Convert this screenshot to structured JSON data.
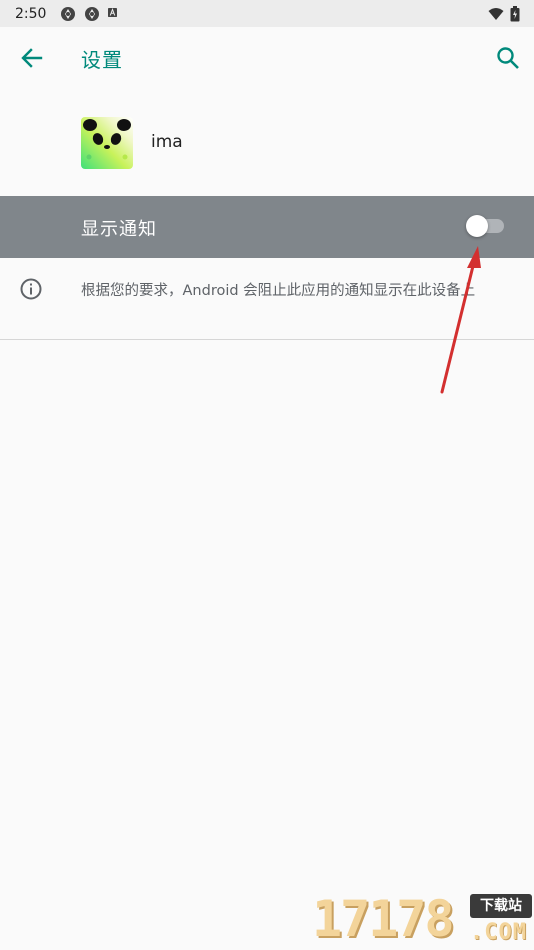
{
  "status_bar": {
    "time": "2:50",
    "left_icons": [
      "aperture-icon",
      "aperture-icon",
      "font-a-icon"
    ],
    "right_icons": [
      "wifi-icon",
      "battery-icon"
    ]
  },
  "toolbar": {
    "title": "设置",
    "back_icon": "arrow-back-icon",
    "search_icon": "search-icon"
  },
  "app": {
    "name": "ima",
    "icon": "panda-app-icon"
  },
  "notification_toggle": {
    "label": "显示通知",
    "state": "off"
  },
  "info": {
    "icon": "info-icon",
    "text": "根据您的要求，Android 会阻止此应用的通知显示在此设备上"
  },
  "watermark": {
    "digits": "17178",
    "badge": "下载站",
    "domain": ".COM"
  },
  "colors": {
    "accent": "#00897b",
    "toggle_row_bg": "#80868b",
    "annotation": "#d32f2f"
  }
}
